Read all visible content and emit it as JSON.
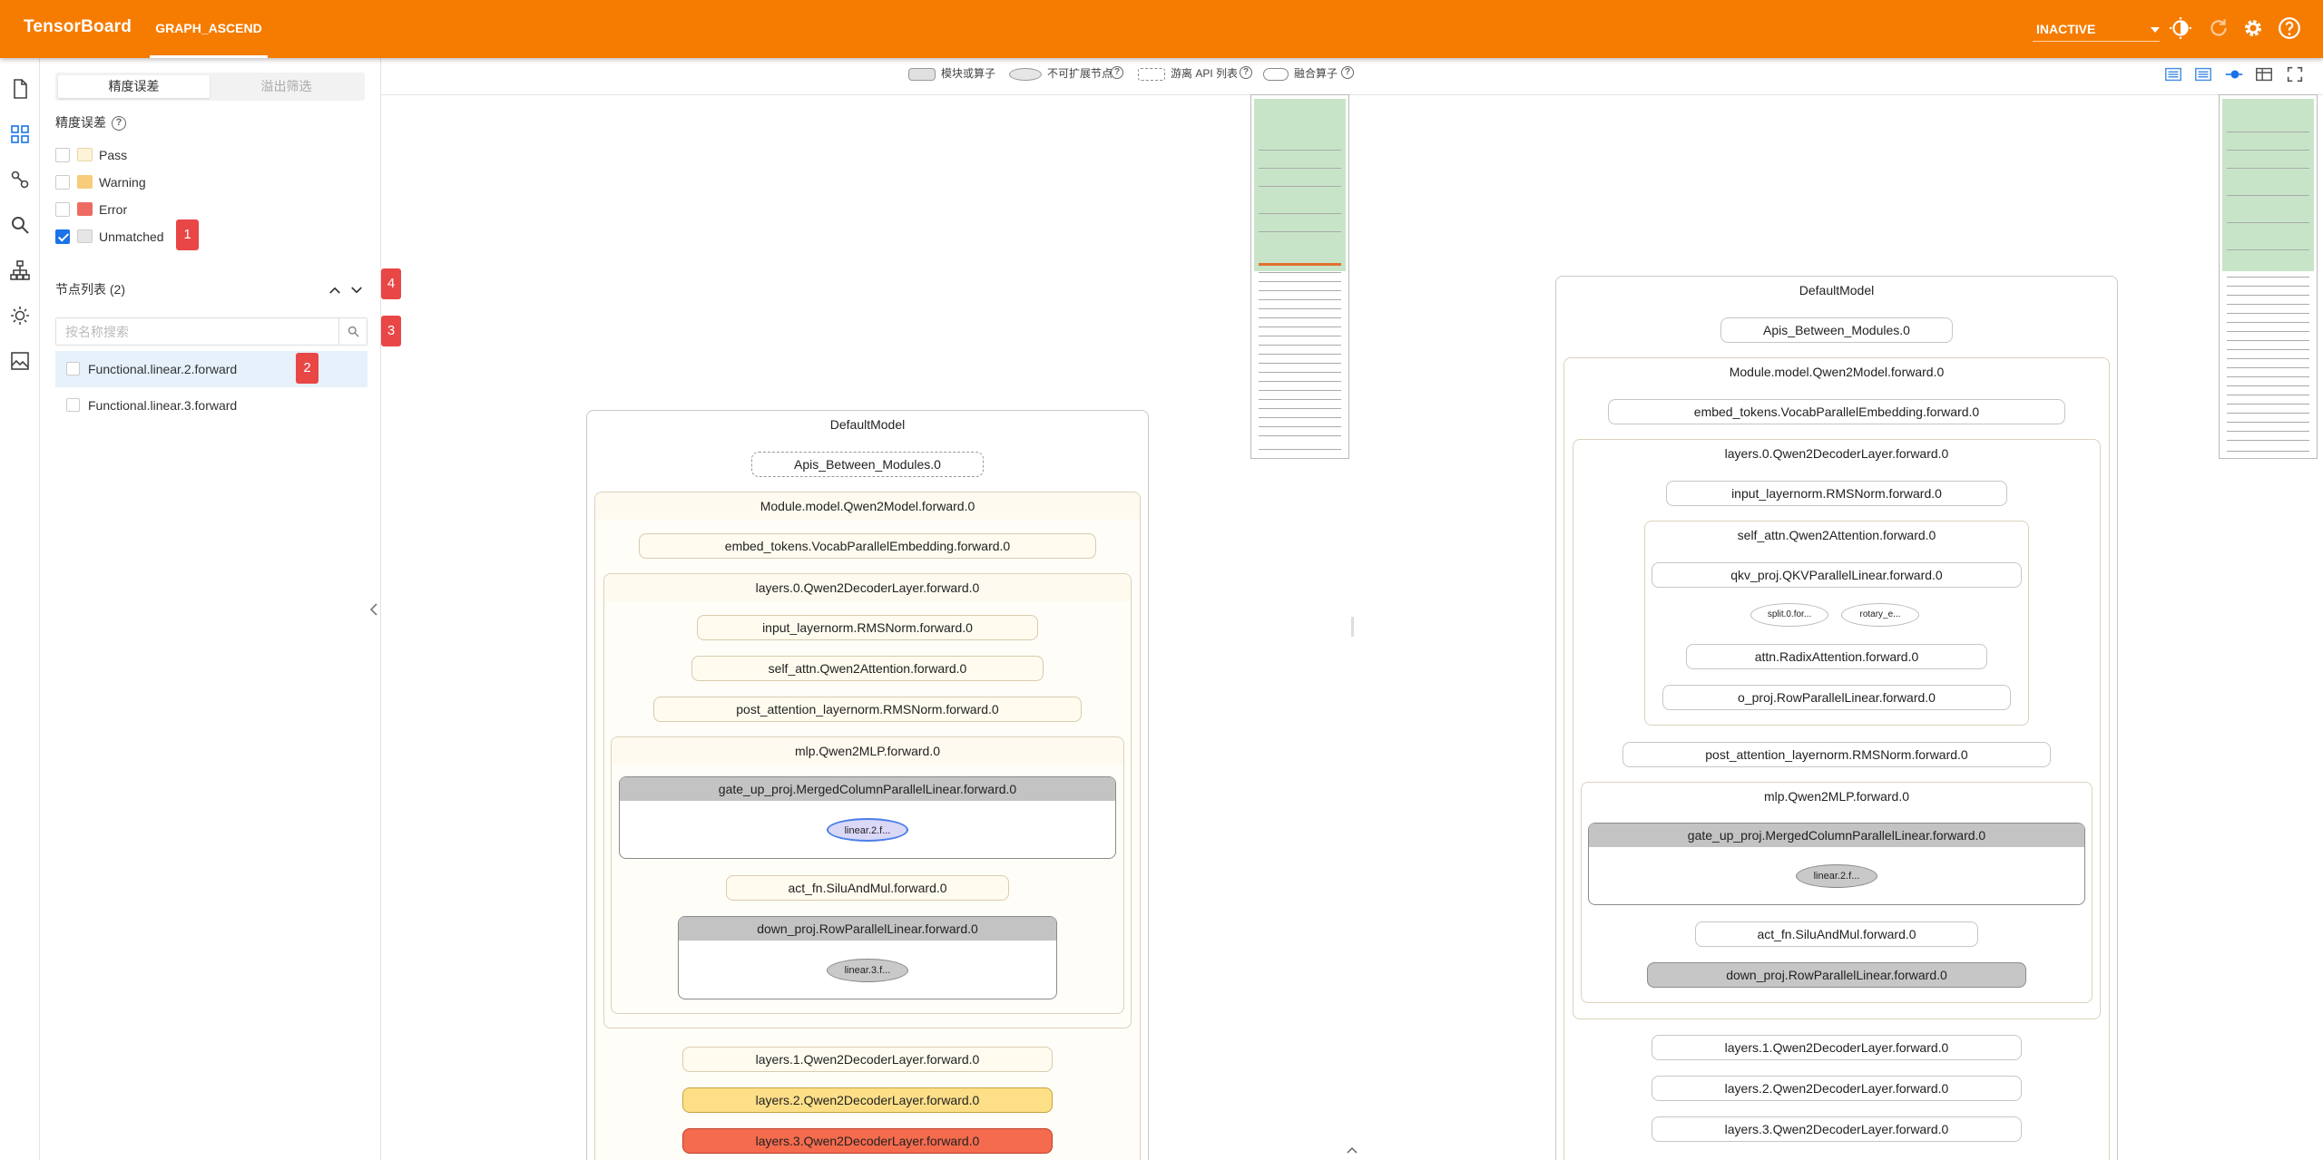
{
  "header": {
    "brand": "TensorBoard",
    "tab": "GRAPH_ASCEND",
    "run": "INACTIVE"
  },
  "sidebar": {
    "tabs": [
      "精度误差",
      "溢出筛选"
    ],
    "section_title": "精度误差",
    "filters": [
      {
        "label": "Pass",
        "color": "#fdf3d9",
        "checked": false
      },
      {
        "label": "Warning",
        "color": "#f7cd7b",
        "checked": false
      },
      {
        "label": "Error",
        "color": "#ee6b64",
        "checked": false
      },
      {
        "label": "Unmatched",
        "color": "#e6e6e6",
        "checked": true
      }
    ],
    "node_list_title": "节点列表 (2)",
    "search_placeholder": "按名称搜索",
    "nodes": [
      "Functional.linear.2.forward",
      "Functional.linear.3.forward"
    ],
    "badges": [
      "1",
      "2",
      "3",
      "4"
    ]
  },
  "legend": {
    "module": "模块或算子",
    "unexpandable": "不可扩展节点",
    "free_api": "游离 API 列表",
    "fused": "融合算子"
  },
  "left_graph": {
    "root": "DefaultModel",
    "apis": "Apis_Between_Modules.0",
    "model": "Module.model.Qwen2Model.forward.0",
    "embed": "embed_tokens.VocabParallelEmbedding.forward.0",
    "layer0": "layers.0.Qwen2DecoderLayer.forward.0",
    "input_ln": "input_layernorm.RMSNorm.forward.0",
    "self_attn": "self_attn.Qwen2Attention.forward.0",
    "post_ln": "post_attention_layernorm.RMSNorm.forward.0",
    "mlp": "mlp.Qwen2MLP.forward.0",
    "gate": "gate_up_proj.MergedColumnParallelLinear.forward.0",
    "lin2": "linear.2.f...",
    "act": "act_fn.SiluAndMul.forward.0",
    "down": "down_proj.RowParallelLinear.forward.0",
    "lin3": "linear.3.f...",
    "layer1": "layers.1.Qwen2DecoderLayer.forward.0",
    "layer2": "layers.2.Qwen2DecoderLayer.forward.0",
    "layer3": "layers.3.Qwen2DecoderLayer.forward.0"
  },
  "right_graph": {
    "root": "DefaultModel",
    "apis": "Apis_Between_Modules.0",
    "model": "Module.model.Qwen2Model.forward.0",
    "embed": "embed_tokens.VocabParallelEmbedding.forward.0",
    "layer0": "layers.0.Qwen2DecoderLayer.forward.0",
    "input_ln": "input_layernorm.RMSNorm.forward.0",
    "self_attn": "self_attn.Qwen2Attention.forward.0",
    "qkv": "qkv_proj.QKVParallelLinear.forward.0",
    "split": "split.0.for...",
    "rotary": "rotary_e...",
    "attn": "attn.RadixAttention.forward.0",
    "o_proj": "o_proj.RowParallelLinear.forward.0",
    "post_ln": "post_attention_layernorm.RMSNorm.forward.0",
    "mlp": "mlp.Qwen2MLP.forward.0",
    "gate": "gate_up_proj.MergedColumnParallelLinear.forward.0",
    "lin2": "linear.2.f...",
    "act": "act_fn.SiluAndMul.forward.0",
    "down": "down_proj.RowParallelLinear.forward.0",
    "layer1": "layers.1.Qwen2DecoderLayer.forward.0",
    "layer2": "layers.2.Qwen2DecoderLayer.forward.0",
    "layer3": "layers.3.Qwen2DecoderLayer.forward.0"
  }
}
